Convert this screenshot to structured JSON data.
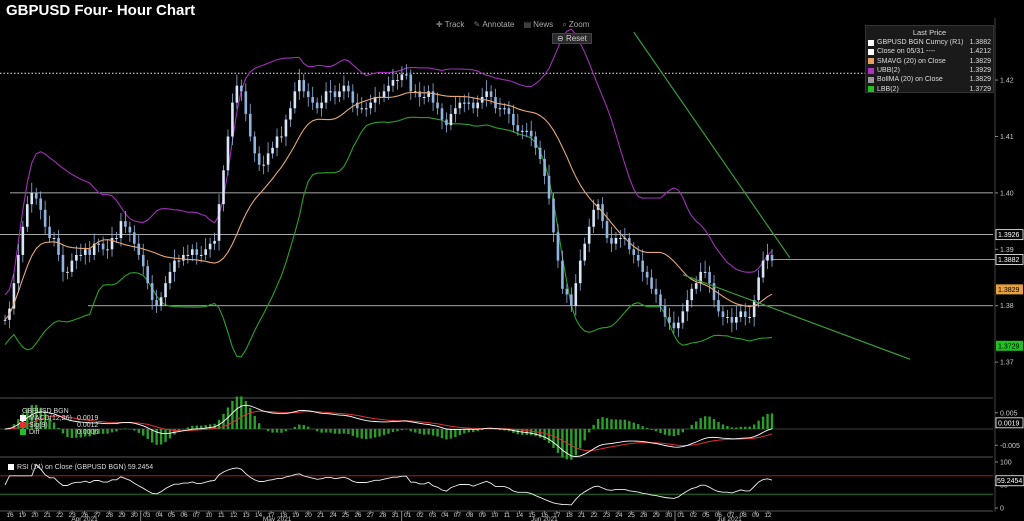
{
  "title": "GBPUSD Four- Hour Chart",
  "toolbar": {
    "track": "Track",
    "annotate": "Annotate",
    "news": "News",
    "zoom": "Zoom",
    "reset": "Reset"
  },
  "legend": {
    "header": "Last Price",
    "rows": [
      {
        "name": "GBPUSD BGN Curncy  (R1)",
        "value": "1.3882",
        "color": "#ffffff"
      },
      {
        "name": "Close on 05/31 ----",
        "value": "1.4212",
        "color": "#ffffff"
      },
      {
        "name": "SMAVG (20)  on Close",
        "value": "1.3829",
        "color": "#e6a060"
      },
      {
        "name": "UBB(2)",
        "value": "1.3929",
        "color": "#b030c0"
      },
      {
        "name": "BollMA (20)  on Close",
        "value": "1.3829",
        "color": "#999999"
      },
      {
        "name": "LBB(2)",
        "value": "1.3729",
        "color": "#20c020"
      }
    ]
  },
  "macd_panel": {
    "label": "GBPUSD BGN",
    "rows": [
      {
        "name": "MACD(12,26)",
        "value": "0.0019",
        "color": "#ffffff"
      },
      {
        "name": "Sig(9)",
        "value": "0.0012",
        "color": "#e03030"
      },
      {
        "name": "Diff",
        "value": "0.0006",
        "color": "#20c020"
      }
    ]
  },
  "rsi_panel": {
    "label": "RSI (14)  on Close (GBPUSD BGN)",
    "value": "59.2454"
  },
  "colors": {
    "candle": "#8fb4e0",
    "sma": "#e6a878",
    "upper_band": "#a030b8",
    "lower_band": "#2aa02a",
    "trendline": "#3a9a3a",
    "level": "#ffffff"
  },
  "chart_data": [
    {
      "type": "candlestick",
      "title": "GBPUSD Four- Hour Chart",
      "y_ticks": [
        "1.37",
        "1.38",
        "1.39",
        "1.40",
        "1.41",
        "1.42"
      ],
      "ylim": [
        1.364,
        1.431
      ],
      "x_ticks": [
        "16",
        "19",
        "20",
        "21",
        "22",
        "23",
        "26",
        "27",
        "28",
        "29",
        "30",
        "03",
        "04",
        "05",
        "06",
        "07",
        "10",
        "11",
        "12",
        "13",
        "14",
        "17",
        "18",
        "19",
        "20",
        "21",
        "24",
        "25",
        "26",
        "27",
        "28",
        "31",
        "01",
        "02",
        "03",
        "04",
        "07",
        "08",
        "09",
        "10",
        "11",
        "14",
        "15",
        "16",
        "17",
        "18",
        "21",
        "22",
        "23",
        "24",
        "25",
        "28",
        "29",
        "30",
        "01",
        "02",
        "05",
        "06",
        "07",
        "08",
        "09",
        "12"
      ],
      "x_months": [
        "Apr 2021",
        "May 2021",
        "Jun 2021",
        "Jul 2021"
      ],
      "horizontal_levels": [
        1.4212,
        1.4,
        1.3926,
        1.38
      ],
      "axis_value_labels": [
        {
          "text": "1.3926",
          "value": 1.3926,
          "color": "#ffffff"
        },
        {
          "text": "1.3882",
          "value": 1.3882,
          "color": "#ffffff"
        },
        {
          "text": "1.3829",
          "value": 1.3829,
          "color": "#e6a040"
        },
        {
          "text": "1.3729",
          "value": 1.3729,
          "color": "#20c020"
        }
      ],
      "close_series": [
        1.3775,
        1.3795,
        1.384,
        1.389,
        1.394,
        1.398,
        1.4,
        1.399,
        1.397,
        1.394,
        1.392,
        1.392,
        1.389,
        1.386,
        1.386,
        1.388,
        1.389,
        1.389,
        1.39,
        1.389,
        1.391,
        1.391,
        1.39,
        1.39,
        1.392,
        1.392,
        1.395,
        1.394,
        1.393,
        1.391,
        1.389,
        1.387,
        1.384,
        1.381,
        1.38,
        1.3815,
        1.384,
        1.386,
        1.388,
        1.388,
        1.389,
        1.389,
        1.39,
        1.389,
        1.389,
        1.39,
        1.391,
        1.3915,
        1.398,
        1.404,
        1.41,
        1.416,
        1.419,
        1.418,
        1.414,
        1.41,
        1.407,
        1.405,
        1.405,
        1.407,
        1.408,
        1.41,
        1.41,
        1.413,
        1.415,
        1.418,
        1.42,
        1.418,
        1.417,
        1.416,
        1.415,
        1.416,
        1.418,
        1.418,
        1.417,
        1.418,
        1.419,
        1.418,
        1.416,
        1.415,
        1.415,
        1.415,
        1.416,
        1.417,
        1.417,
        1.418,
        1.419,
        1.42,
        1.42,
        1.421,
        1.421,
        1.418,
        1.418,
        1.417,
        1.417,
        1.418,
        1.416,
        1.415,
        1.413,
        1.412,
        1.414,
        1.415,
        1.416,
        1.416,
        1.416,
        1.415,
        1.416,
        1.417,
        1.418,
        1.417,
        1.415,
        1.415,
        1.415,
        1.414,
        1.412,
        1.411,
        1.411,
        1.411,
        1.41,
        1.408,
        1.406,
        1.403,
        1.399,
        1.393,
        1.388,
        1.383,
        1.382,
        1.38,
        1.384,
        1.388,
        1.391,
        1.394,
        1.397,
        1.398,
        1.395,
        1.392,
        1.391,
        1.392,
        1.392,
        1.392,
        1.39,
        1.389,
        1.388,
        1.386,
        1.385,
        1.383,
        1.382,
        1.38,
        1.378,
        1.377,
        1.376,
        1.377,
        1.379,
        1.381,
        1.383,
        1.384,
        1.386,
        1.386,
        1.384,
        1.381,
        1.379,
        1.378,
        1.378,
        1.377,
        1.378,
        1.379,
        1.378,
        1.378,
        1.381,
        1.385,
        1.388,
        1.389,
        1.388
      ],
      "series": [
        {
          "name": "GBPUSD BGN Curncy  (R1)",
          "last": 1.3882
        },
        {
          "name": "SMAVG (20)  on Close",
          "last": 1.3829
        },
        {
          "name": "UBB(2)",
          "last": 1.3929
        },
        {
          "name": "BollMA (20)  on Close",
          "last": 1.3829
        },
        {
          "name": "LBB(2)",
          "last": 1.3729
        }
      ],
      "trendlines": [
        {
          "from_index": 141,
          "from_value": 1.4285,
          "to_index": 176,
          "to_value": 1.3885
        },
        {
          "from_index": 152,
          "from_value": 1.3855,
          "to_index": 203,
          "to_value": 1.3705
        }
      ]
    },
    {
      "type": "line",
      "title": "GBPUSD BGN",
      "y_ticks": [
        "0.005",
        "-0.005"
      ],
      "ylim": [
        -0.008,
        0.008
      ],
      "value_label": "0.0019",
      "series": [
        {
          "name": "MACD(12,26)",
          "last": 0.0019
        },
        {
          "name": "Sig(9)",
          "last": 0.0012
        },
        {
          "name": "Diff",
          "last": 0.0006
        }
      ]
    },
    {
      "type": "line",
      "title": "RSI (14)  on Close (GBPUSD BGN)",
      "y_ticks": [
        "100",
        "50",
        "0"
      ],
      "ylim": [
        0,
        100
      ],
      "reference_lines": [
        70,
        30
      ],
      "value_label": "59.2454",
      "series": [
        {
          "name": "RSI (14)",
          "last": 59.2454
        }
      ]
    }
  ]
}
